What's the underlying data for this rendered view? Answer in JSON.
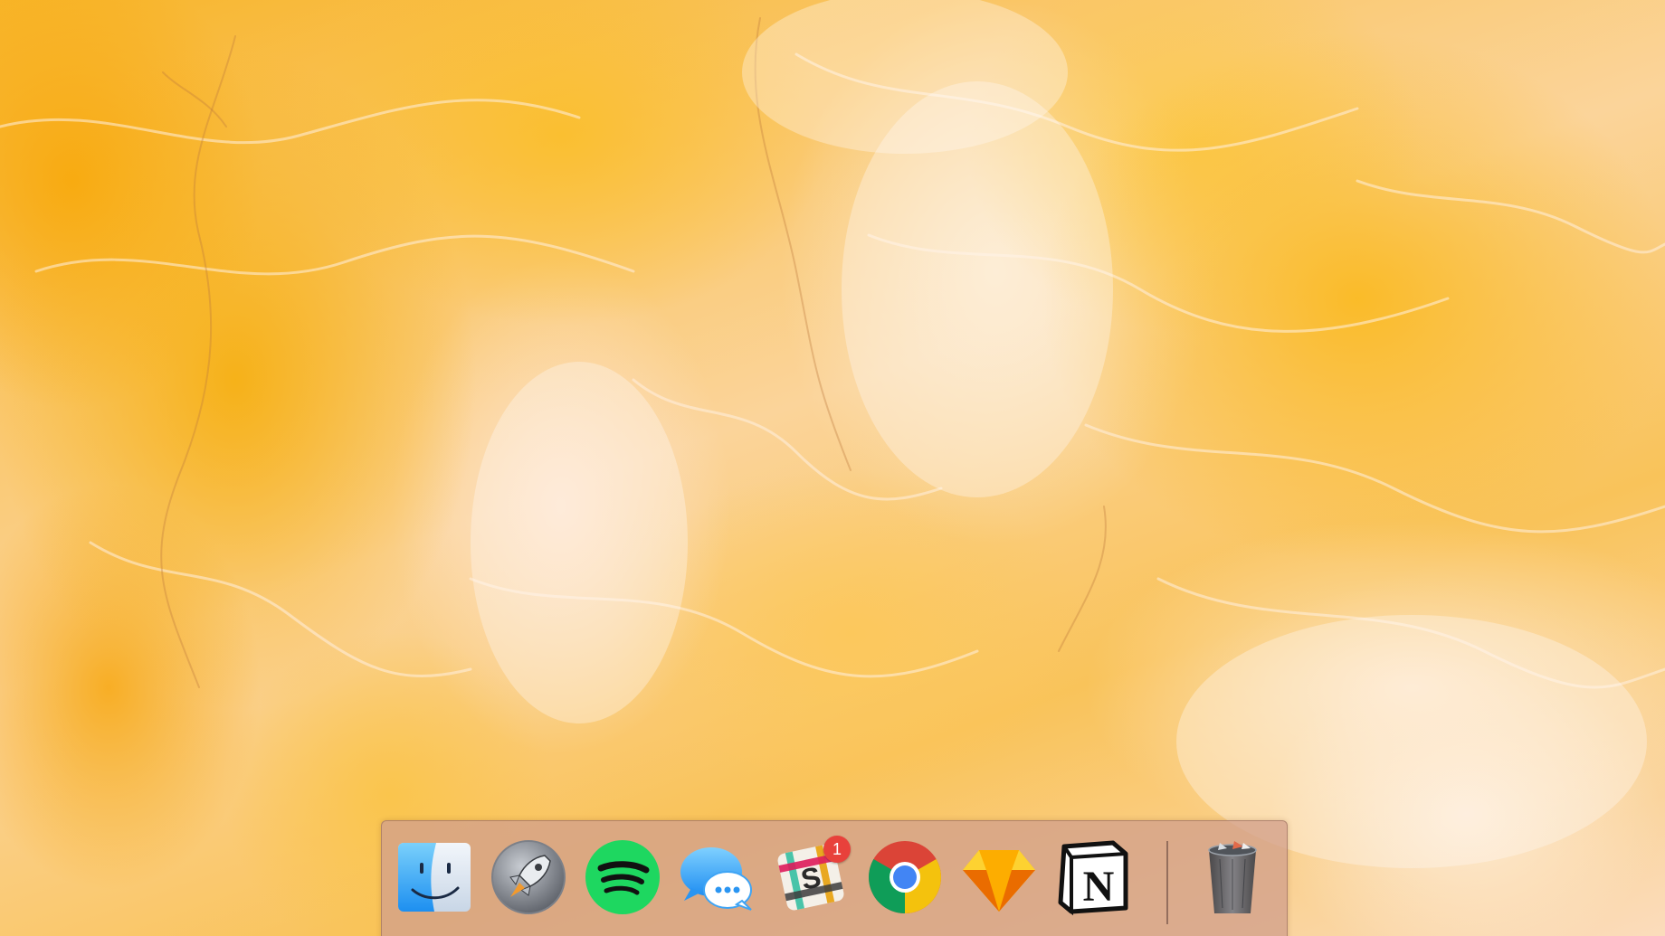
{
  "wallpaper": {
    "description_icon": "rock-texture-wallpaper"
  },
  "dock": {
    "apps": [
      {
        "id": "finder",
        "icon": "finder-icon",
        "running": true,
        "badge": null
      },
      {
        "id": "launchpad",
        "icon": "launchpad-icon",
        "running": false,
        "badge": null
      },
      {
        "id": "spotify",
        "icon": "spotify-icon",
        "running": true,
        "badge": null
      },
      {
        "id": "messages",
        "icon": "messages-icon",
        "running": false,
        "badge": null
      },
      {
        "id": "slack",
        "icon": "slack-icon",
        "running": true,
        "badge": "1"
      },
      {
        "id": "chrome",
        "icon": "chrome-icon",
        "running": true,
        "badge": null
      },
      {
        "id": "sketch",
        "icon": "sketch-icon",
        "running": true,
        "badge": null
      },
      {
        "id": "notion",
        "icon": "notion-icon",
        "running": true,
        "badge": null
      }
    ],
    "trash": {
      "icon": "trash-icon"
    },
    "colors": {
      "spotify_green": "#1ed760",
      "badge_red": "#e8413b",
      "chrome_red": "#db4437",
      "chrome_yellow": "#f4c20d",
      "chrome_green": "#0f9d58",
      "chrome_blue": "#4285f4",
      "sketch_orange": "#f7a21b"
    },
    "slack_badge_count": "1"
  }
}
